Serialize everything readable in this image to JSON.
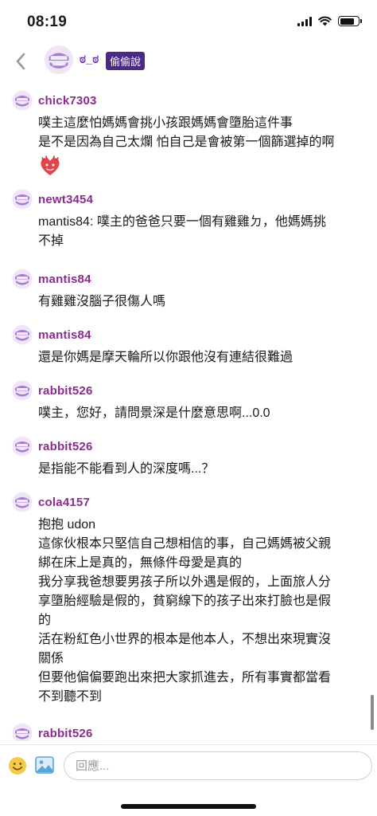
{
  "status_bar": {
    "time": "08:19"
  },
  "header": {
    "name": "ಠ_ಠ",
    "tag": "偷偷說"
  },
  "messages": [
    {
      "user": "chick7303",
      "lines": [
        "噗主這麼怕媽媽會挑小孩跟媽媽會墮胎這件事",
        "是不是因為自己太爛 怕自己是會被第一個篩選掉的啊"
      ],
      "sticker": "red-heart-face-sticker"
    },
    {
      "user": "newt3454",
      "lines": [
        "mantis84: 噗主的爸爸只要一個有雞雞ㄉ，他媽媽挑",
        "不掉"
      ]
    },
    {
      "user": "mantis84",
      "lines": [
        "有雞雞沒腦子很傷人嗎"
      ]
    },
    {
      "user": "mantis84",
      "lines": [
        "還是你媽是摩天輪所以你跟他沒有連結很難過"
      ]
    },
    {
      "user": "rabbit526",
      "lines": [
        "噗主，您好，請問景深是什麼意思啊...0.0"
      ]
    },
    {
      "user": "rabbit526",
      "lines": [
        "是指能不能看到人的深度嗎...？"
      ]
    },
    {
      "user": "cola4157",
      "lines": [
        "抱抱 udon",
        "這傢伙根本只堅信自己想相信的事，自己媽媽被父親",
        "綁在床上是真的，無條件母愛是真的",
        "我分享我爸想要男孩子所以外遇是假的，上面旅人分",
        "享墮胎經驗是假的，貧窮線下的孩子出來打臉也是假",
        "的",
        "活在粉紅色小世界的根本是他本人，不想出來現實沒",
        "關係",
        "但要他偏偏要跑出來把大家抓進去，所有事實都當看",
        "不到聽不到"
      ]
    },
    {
      "user": "rabbit526",
      "lines": []
    }
  ],
  "reply": {
    "placeholder": "回應..."
  },
  "colors": {
    "username": "#8b2d8f",
    "tag_bg": "#4a2a86",
    "avatar": "#a77ad0"
  }
}
